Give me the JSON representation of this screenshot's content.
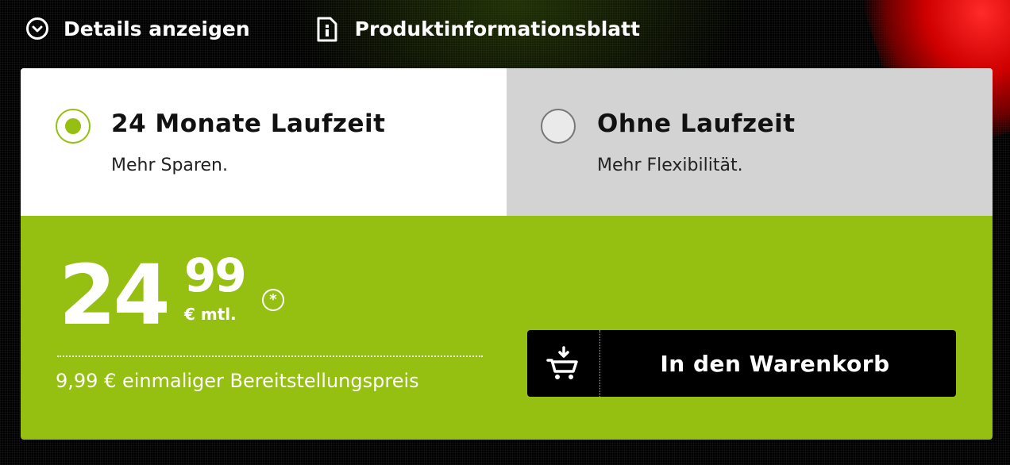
{
  "toplinks": {
    "details_label": "Details anzeigen",
    "details_icon": "chevron-down-circle-icon",
    "info_label": "Produktinformationsblatt",
    "info_icon": "document-info-icon"
  },
  "tariff_options": [
    {
      "title": "24 Monate Laufzeit",
      "subtitle": "Mehr Sparen.",
      "selected": true
    },
    {
      "title": "Ohne Laufzeit",
      "subtitle": "Mehr Flexibilität.",
      "selected": false
    }
  ],
  "price": {
    "euros": "24",
    "cents": "99",
    "unit": "€ mtl.",
    "footnote_symbol": "*",
    "setup_fee": "9,99 € einmaliger Bereitstellungspreis"
  },
  "cart_button": {
    "label": "In den Warenkorb",
    "icon": "add-to-cart-icon"
  },
  "colors": {
    "accent_green": "#95c011",
    "unselected_gray": "#d3d3d3",
    "button_black": "#000000"
  }
}
